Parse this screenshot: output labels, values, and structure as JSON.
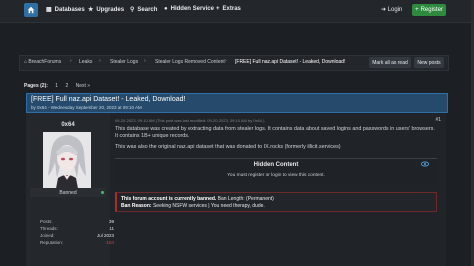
{
  "nav": {
    "items": [
      {
        "label": "Databases",
        "icon": "database-icon"
      },
      {
        "label": "Upgrades",
        "icon": "star-icon"
      },
      {
        "label": "Search",
        "icon": "search-icon"
      },
      {
        "label": "Hidden Service",
        "icon": "user-secret-icon"
      },
      {
        "label": "Extras",
        "icon": "plus-icon"
      }
    ],
    "login": "Login",
    "register": "Register"
  },
  "breadcrumb": {
    "items": [
      "BreachForums",
      "Leaks",
      "Stealer Logs",
      "Stealer Logs Removed Content"
    ],
    "current": "[FREE] Full naz.api Dataset! - Leaked, Download!",
    "mark_read": "Mark all as read",
    "new_posts": "New posts"
  },
  "pagination": {
    "label": "Pages (2):",
    "pages": [
      "1",
      "2"
    ],
    "next": "Next »"
  },
  "thread": {
    "title": "[FREE] Full naz.api Dataset! - Leaked, Download!",
    "meta": "by 0x64 - Wednesday September 20, 2023 at 09:10 AM"
  },
  "post": {
    "username": "0x64",
    "status": "Banned",
    "stats": [
      {
        "k": "Posts:",
        "v": "39"
      },
      {
        "k": "Threads:",
        "v": "11"
      },
      {
        "k": "Joined:",
        "v": "Jul 2023"
      },
      {
        "k": "Reputation:",
        "v": "-104",
        "neg": true
      }
    ],
    "date": "09-20-2023, 09:10 AM (This post was last modified: 09-20-2023, 09:10 AM by 0x64.)",
    "number": "#1",
    "text1": "This database was created by extracting data from stealer logs. It contains data about saved logins and passwords in users' browsers. It contains 1B+ unique records.",
    "text2": "This was also the original naz.api dataset that was donated to IX.rocks (formerly illicit.services)",
    "hidden_title": "Hidden Content",
    "hidden_sub": "You must register or login to view this content.",
    "ban_bold1": "This forum account is currently banned.",
    "ban_rest1": " Ban Length: (Permanent)",
    "ban_bold2": "Ban Reason:",
    "ban_rest2": " Seeking NSFW services | You need therapy, dude."
  },
  "colors": {
    "accent": "#2f6fa3",
    "register": "#2d8a3e",
    "ban_border": "#b02a2a",
    "reputation_negative": "#d34040"
  }
}
